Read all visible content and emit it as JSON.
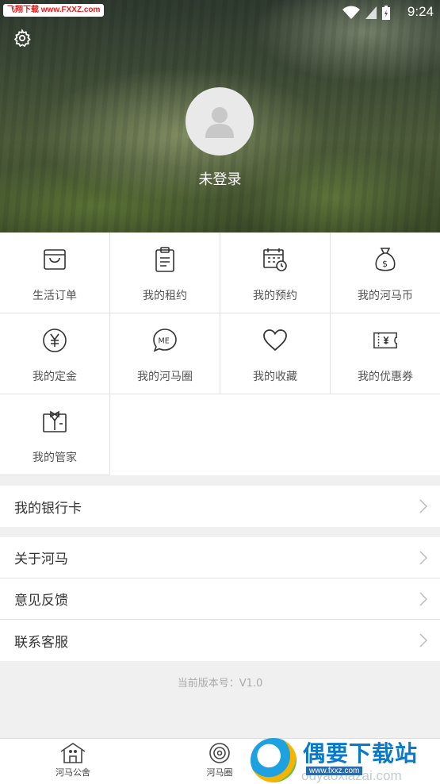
{
  "status_bar": {
    "time": "9:24",
    "watermark": "飞翔下载 www.FXXZ.com"
  },
  "profile": {
    "login_text": "未登录"
  },
  "menu_grid": [
    {
      "label": "生活订单",
      "icon": "shopping-bag-icon"
    },
    {
      "label": "我的租约",
      "icon": "clipboard-icon"
    },
    {
      "label": "我的预约",
      "icon": "calendar-clock-icon"
    },
    {
      "label": "我的河马币",
      "icon": "money-bag-icon"
    },
    {
      "label": "我的定金",
      "icon": "yen-circle-icon"
    },
    {
      "label": "我的河马圈",
      "icon": "me-chat-icon"
    },
    {
      "label": "我的收藏",
      "icon": "heart-icon"
    },
    {
      "label": "我的优惠券",
      "icon": "coupon-icon"
    },
    {
      "label": "我的管家",
      "icon": "butler-icon"
    }
  ],
  "list_group_1": [
    {
      "label": "我的银行卡"
    }
  ],
  "list_group_2": [
    {
      "label": "关于河马"
    },
    {
      "label": "意见反馈"
    },
    {
      "label": "联系客服"
    }
  ],
  "version": "当前版本号：V1.0",
  "tabbar": [
    {
      "label": "河马公舍",
      "icon": "house-icon"
    },
    {
      "label": "河马圈",
      "icon": "target-circle-icon"
    }
  ],
  "watermark_br": {
    "title": "偶要下载站",
    "url": "www.fxxz.com",
    "sub": "ouyaoxiazai.com"
  }
}
